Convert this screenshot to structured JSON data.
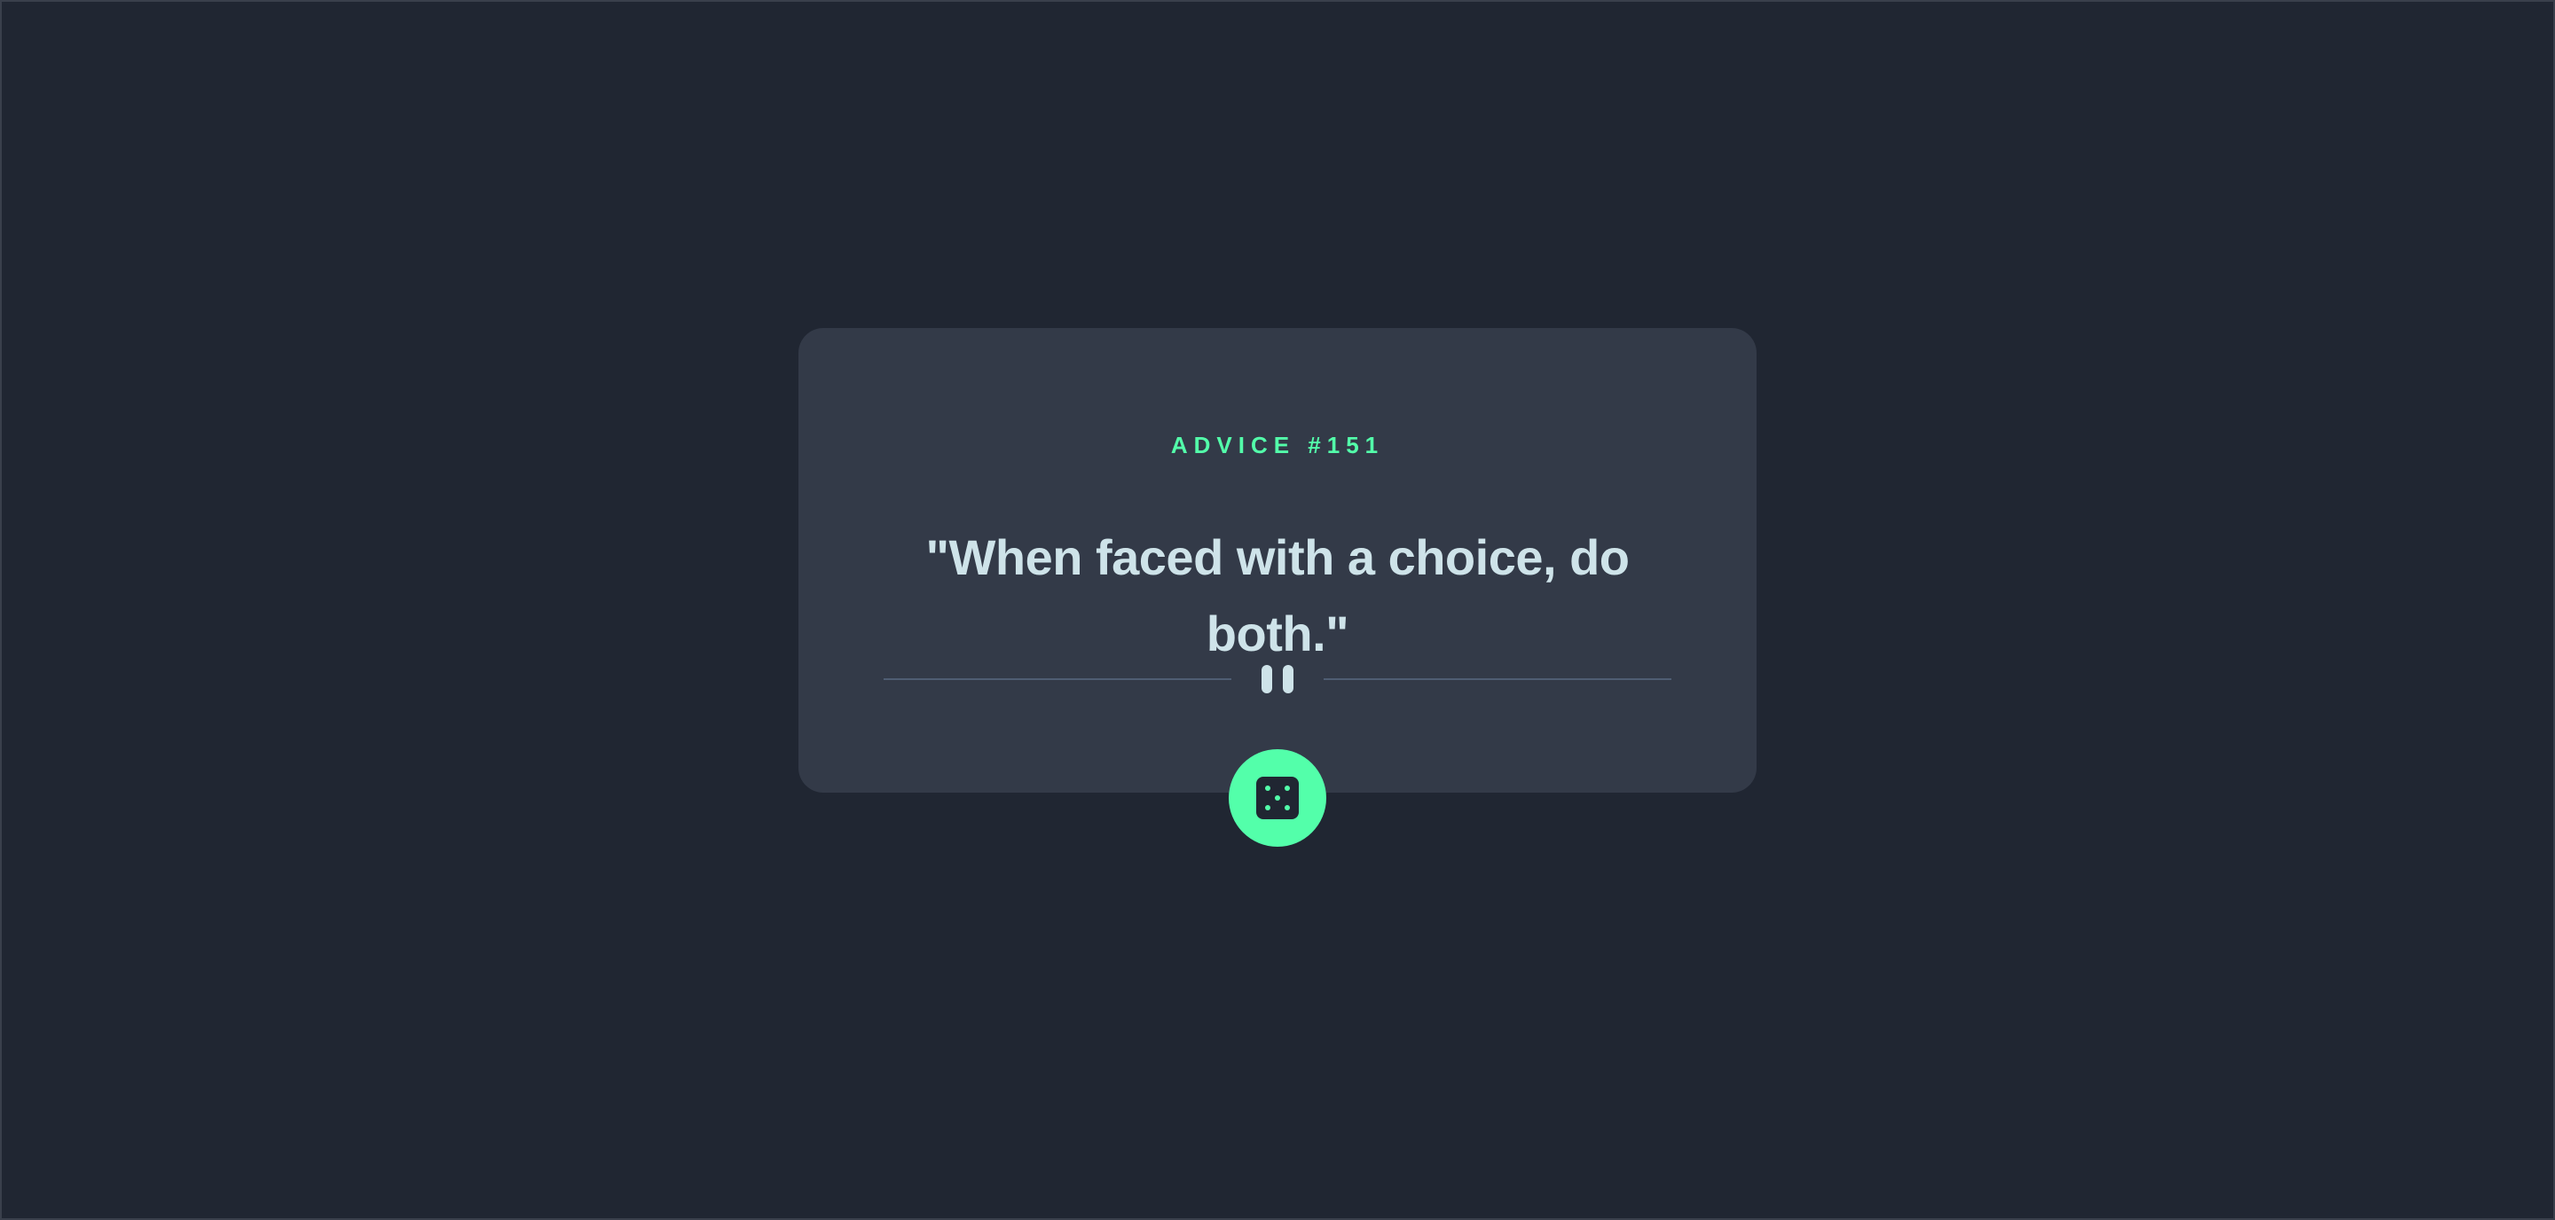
{
  "advice": {
    "heading": "ADVICE #151",
    "quote": "\"When faced with a choice, do both.\""
  },
  "icons": {
    "divider": "pause-icon",
    "generate": "dice-icon"
  },
  "colors": {
    "background": "#202632",
    "card": "#333a48",
    "accent": "#53ffaa",
    "text": "#cee3e9",
    "divider": "#4f5d73"
  }
}
